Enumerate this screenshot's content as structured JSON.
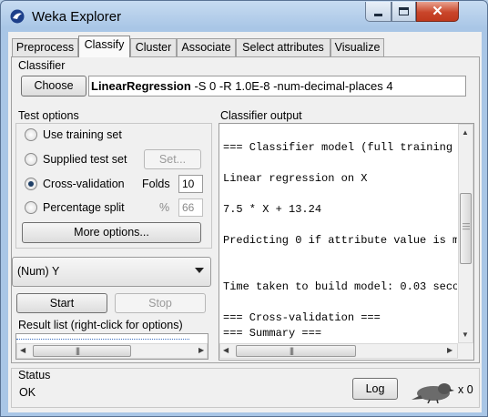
{
  "window": {
    "title": "Weka Explorer",
    "icon": "weka-bird-icon"
  },
  "tabs": [
    {
      "label": "Preprocess",
      "active": false
    },
    {
      "label": "Classify",
      "active": true
    },
    {
      "label": "Cluster",
      "active": false
    },
    {
      "label": "Associate",
      "active": false
    },
    {
      "label": "Select attributes",
      "active": false
    },
    {
      "label": "Visualize",
      "active": false
    }
  ],
  "classifier": {
    "section_label": "Classifier",
    "choose_label": "Choose",
    "name": "LinearRegression",
    "options": " -S 0 -R 1.0E-8 -num-decimal-places 4"
  },
  "test_options": {
    "section_label": "Test options",
    "use_training": "Use training set",
    "supplied_test": "Supplied test set",
    "set_button": "Set...",
    "cross_validation": "Cross-validation",
    "folds_label": "Folds",
    "folds_value": "10",
    "percentage_split": "Percentage split",
    "percent_symbol": "%",
    "percent_value": "66",
    "more_options": "More options...",
    "selected": "cross_validation"
  },
  "target": {
    "selected": "(Num) Y"
  },
  "actions": {
    "start": "Start",
    "stop": "Stop"
  },
  "result_list": {
    "label": "Result list (right-click for options)"
  },
  "output": {
    "section_label": "Classifier output",
    "lines": [
      "",
      "=== Classifier model (full training",
      "",
      "Linear regression on X",
      "",
      "7.5 * X + 13.24",
      "",
      "Predicting 0 if attribute value is m",
      "",
      "",
      "Time taken to build model: 0.03 seco",
      "",
      "=== Cross-validation ===",
      "=== Summary ==="
    ]
  },
  "status": {
    "label": "Status",
    "text": "OK",
    "log_button": "Log",
    "count": "x 0"
  },
  "colors": {
    "title_gradient_top": "#c7dbf1",
    "close_button": "#c9452a",
    "panel": "#f0f0f0"
  }
}
